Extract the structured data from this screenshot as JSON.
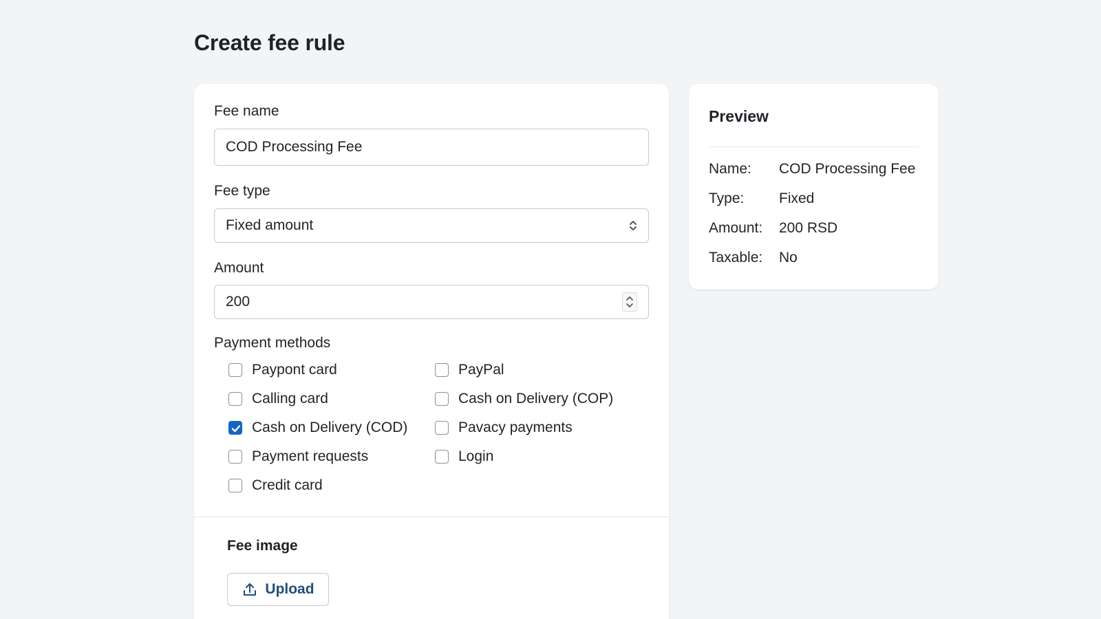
{
  "page": {
    "title": "Create fee rule"
  },
  "form": {
    "fee_name": {
      "label": "Fee name",
      "value": "COD Processing Fee"
    },
    "fee_type": {
      "label": "Fee type",
      "value": "Fixed amount"
    },
    "amount": {
      "label": "Amount",
      "value": "200"
    },
    "payment_methods": {
      "label": "Payment methods",
      "items": [
        {
          "label": "Paypont card",
          "checked": false
        },
        {
          "label": "Calling card",
          "checked": false
        },
        {
          "label": "Cash on Delivery (COD)",
          "checked": true
        },
        {
          "label": "Payment requests",
          "checked": false
        },
        {
          "label": "Credit card",
          "checked": false
        },
        {
          "label": "PayPal",
          "checked": false
        },
        {
          "label": "Cash on Delivery (COP)",
          "checked": false
        },
        {
          "label": "Pavacy payments",
          "checked": false
        },
        {
          "label": "Login",
          "checked": false
        }
      ]
    },
    "fee_image": {
      "title": "Fee image",
      "upload_label": "Upload"
    }
  },
  "preview": {
    "title": "Preview",
    "rows": [
      {
        "key": "Name:",
        "value": "COD Processing Fee"
      },
      {
        "key": "Type:",
        "value": "Fixed"
      },
      {
        "key": "Amount:",
        "value": "200 RSD"
      },
      {
        "key": "Taxable:",
        "value": "No"
      }
    ]
  },
  "colors": {
    "background": "#f3f4f6",
    "card": "#ffffff",
    "accent": "#1565c8",
    "upload_text": "#1f4e7a"
  },
  "icons": {
    "select": "select-arrows-icon",
    "stepper": "stepper-icon",
    "check": "check-icon",
    "upload": "upload-icon"
  }
}
